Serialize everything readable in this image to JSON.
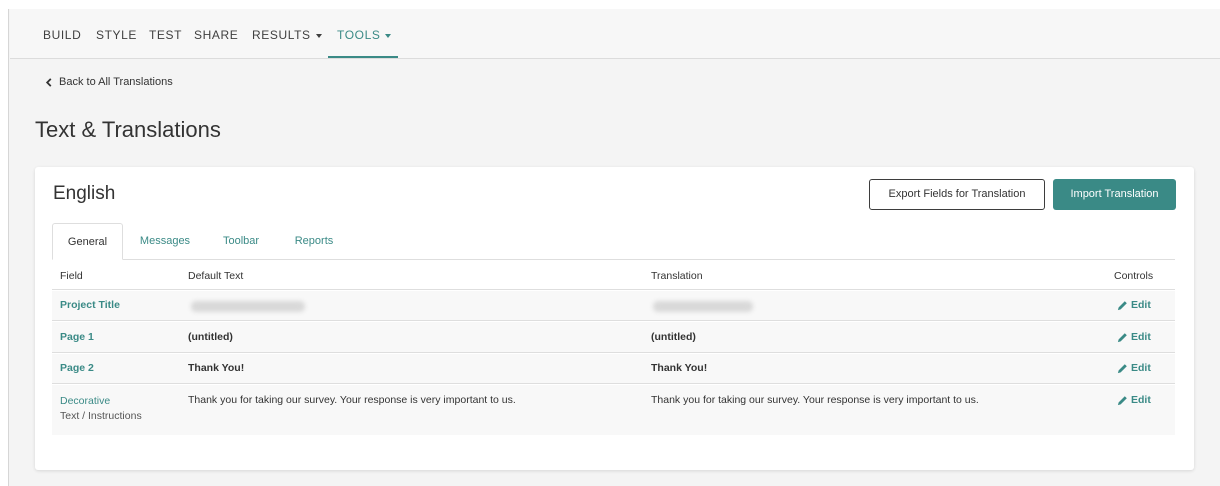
{
  "nav": {
    "items": [
      {
        "label": "BUILD",
        "has_caret": false
      },
      {
        "label": "STYLE",
        "has_caret": false
      },
      {
        "label": "TEST",
        "has_caret": false
      },
      {
        "label": "SHARE",
        "has_caret": false
      },
      {
        "label": "RESULTS",
        "has_caret": true
      },
      {
        "label": "TOOLS",
        "has_caret": true
      }
    ],
    "active": "TOOLS"
  },
  "back_link": {
    "label": "Back to All Translations",
    "icon": "chevron-left-icon"
  },
  "page_title": "Text & Translations",
  "card": {
    "language": "English",
    "export_button": "Export Fields for Translation",
    "import_button": "Import Translation"
  },
  "tabs": [
    "General",
    "Messages",
    "Toolbar",
    "Reports"
  ],
  "active_tab": "General",
  "table": {
    "headers": {
      "field": "Field",
      "default_text": "Default Text",
      "translation": "Translation",
      "controls": "Controls"
    },
    "rows": [
      {
        "field": "Project Title",
        "default_text": "",
        "translation": "",
        "blurred": true
      },
      {
        "field": "Page 1",
        "default_text": "(untitled)",
        "translation": "(untitled)"
      },
      {
        "field": "Page 2",
        "default_text": "Thank You!",
        "translation": "Thank You!"
      },
      {
        "field": "Decorative",
        "field_sub": "Text / Instructions",
        "default_text": "Thank you for taking our survey. Your response is very important to us.",
        "translation": "Thank you for taking our survey. Your response is very important to us."
      }
    ],
    "edit_label": "Edit",
    "edit_icon": "pencil-icon"
  },
  "colors": {
    "accent": "#3a8a86",
    "background": "#f4f4f4",
    "card": "#ffffff",
    "row": "#f8f8f8"
  }
}
